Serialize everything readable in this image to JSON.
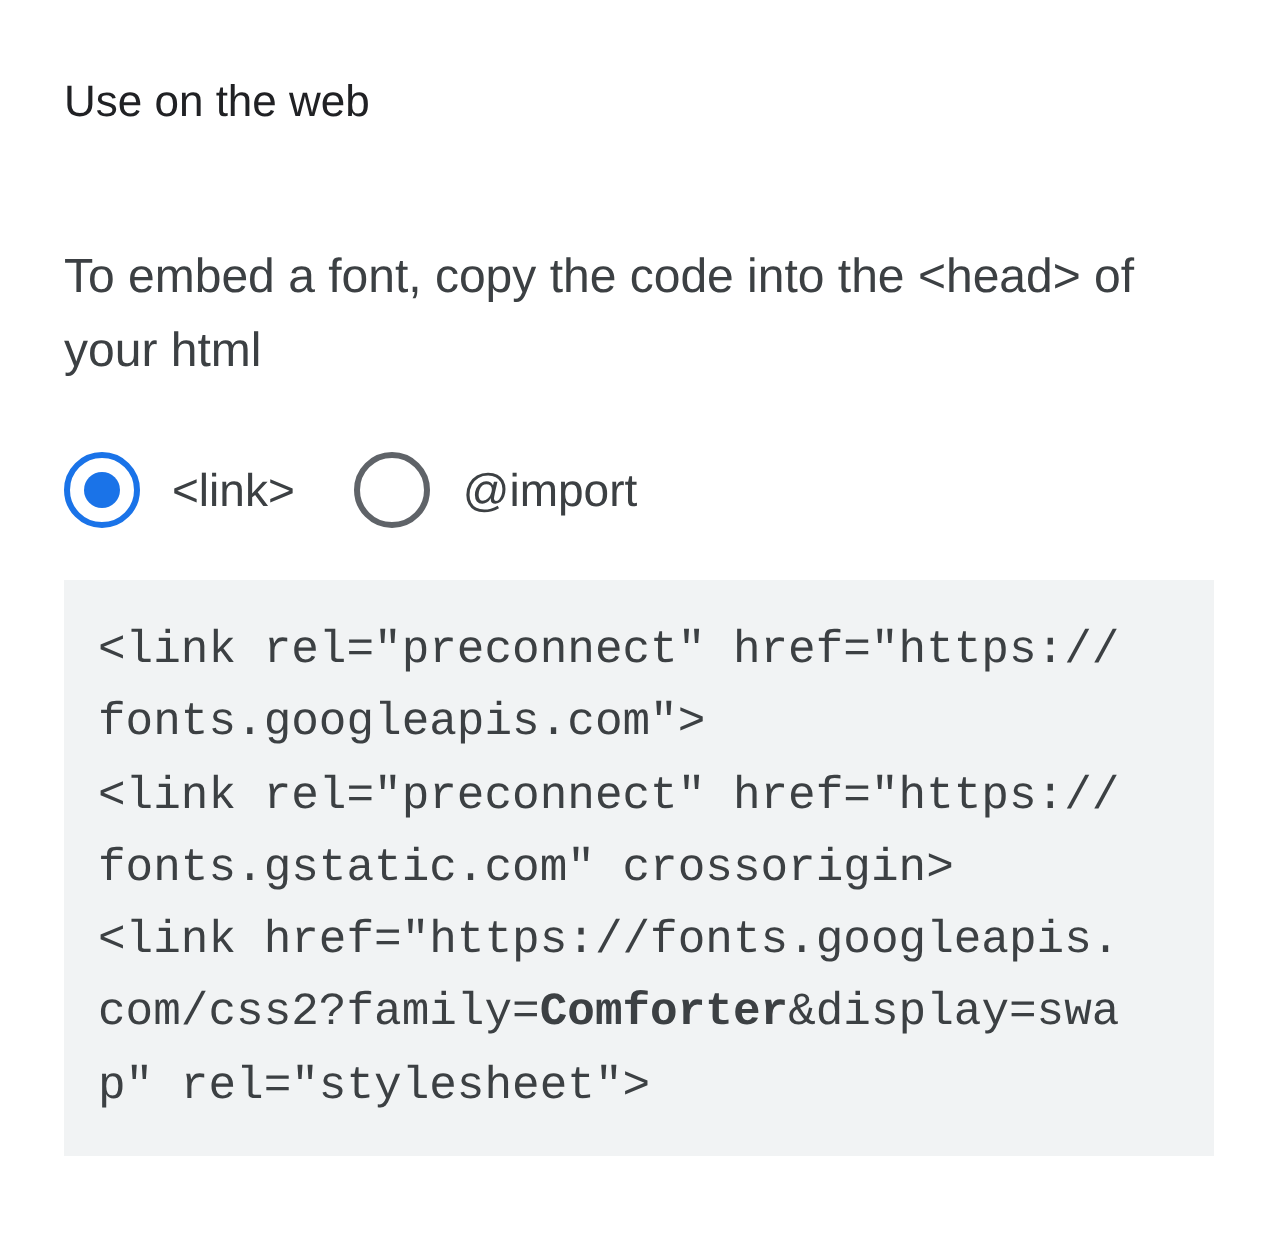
{
  "title": "Use on the web",
  "description": "To embed a font, copy the code into the <head> of your html",
  "options": [
    {
      "label": "<link>",
      "selected": true
    },
    {
      "label": "@import",
      "selected": false
    }
  ],
  "code_lines": [
    "<link rel=\"preconnect\" href=\"https://",
    "fonts.googleapis.com\">",
    "<link rel=\"preconnect\" href=\"https://",
    "fonts.gstatic.com\" crossorigin>",
    "<link href=\"https://fonts.googleapis.",
    "com/css2?family=**Comforter**&display=swa",
    "p\" rel=\"stylesheet\">"
  ]
}
